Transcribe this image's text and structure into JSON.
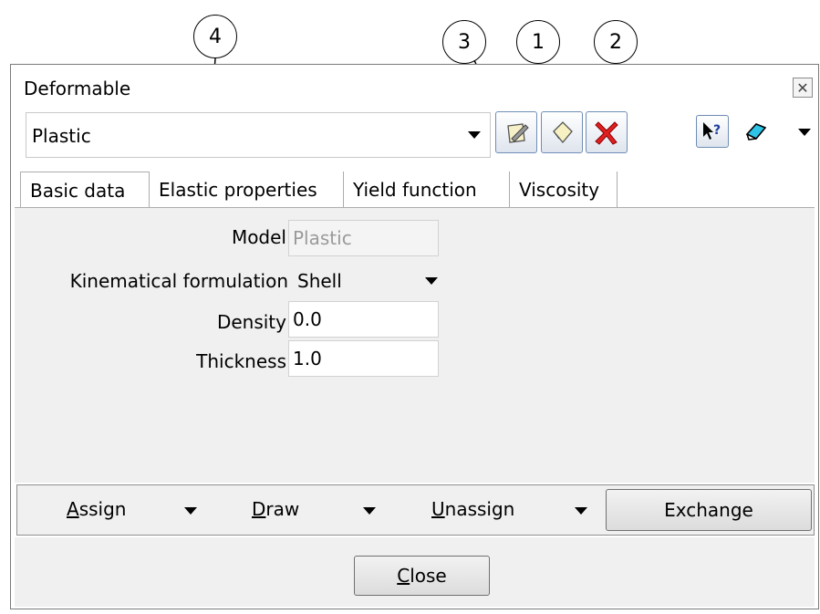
{
  "callouts": [
    "4",
    "3",
    "1",
    "2"
  ],
  "window": {
    "title": "Deformable"
  },
  "material": {
    "selected": "Plastic"
  },
  "tabs": [
    "Basic data",
    "Elastic properties",
    "Yield function",
    "Viscosity"
  ],
  "basic": {
    "model_label": "Model",
    "model_value": "Plastic",
    "kin_label": "Kinematical formulation",
    "kin_value": "Shell",
    "density_label": "Density",
    "density_value": "0.0",
    "thickness_label": "Thickness",
    "thickness_value": "1.0"
  },
  "actions": {
    "assign_first": "A",
    "assign_rest": "ssign",
    "draw_first": "D",
    "draw_rest": "raw",
    "unassign_first": "U",
    "unassign_rest": "nassign",
    "exchange": "Exchange"
  },
  "footer": {
    "close_first": "C",
    "close_rest": "lose"
  },
  "icons": [
    "rename-icon",
    "new-material-icon",
    "delete-icon",
    "help-pointer-icon",
    "eraser-icon"
  ],
  "colors": {
    "delete_red": "#e02020",
    "help_blue": "#1c3d9c",
    "eraser_cyan": "#2ec4e8"
  }
}
